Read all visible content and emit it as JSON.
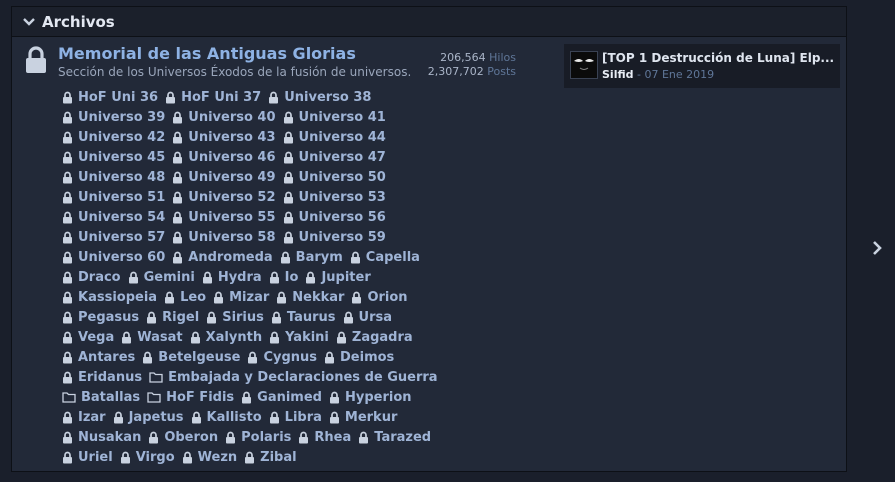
{
  "section": {
    "title": "Archivos"
  },
  "forum": {
    "title": "Memorial de las Antiguas Glorias",
    "description": "Sección de los Universos Éxodos de la fusión de universos.",
    "threads_count": "206,564",
    "threads_label": "Hilos",
    "posts_count": "2,307,702",
    "posts_label": "Posts"
  },
  "last_post": {
    "title": "[TOP 1 Destrucción de Luna] Elp...",
    "user": "Silfid",
    "separator": " - ",
    "date": "07 Ene 2019"
  },
  "subforums": [
    [
      {
        "label": "HoF Uni 36",
        "icon": "lock-icon"
      },
      {
        "label": "HoF Uni 37",
        "icon": "lock-icon"
      },
      {
        "label": "Universo 38",
        "icon": "lock-icon"
      }
    ],
    [
      {
        "label": "Universo 39",
        "icon": "lock-icon"
      },
      {
        "label": "Universo 40",
        "icon": "lock-icon"
      },
      {
        "label": "Universo 41",
        "icon": "lock-icon"
      }
    ],
    [
      {
        "label": "Universo 42",
        "icon": "lock-icon"
      },
      {
        "label": "Universo 43",
        "icon": "lock-icon"
      },
      {
        "label": "Universo 44",
        "icon": "lock-icon"
      }
    ],
    [
      {
        "label": "Universo 45",
        "icon": "lock-icon"
      },
      {
        "label": "Universo 46",
        "icon": "lock-icon"
      },
      {
        "label": "Universo 47",
        "icon": "lock-icon"
      }
    ],
    [
      {
        "label": "Universo 48",
        "icon": "lock-icon"
      },
      {
        "label": "Universo 49",
        "icon": "lock-icon"
      },
      {
        "label": "Universo 50",
        "icon": "lock-icon"
      }
    ],
    [
      {
        "label": "Universo 51",
        "icon": "lock-icon"
      },
      {
        "label": "Universo 52",
        "icon": "lock-icon"
      },
      {
        "label": "Universo 53",
        "icon": "lock-icon"
      }
    ],
    [
      {
        "label": "Universo 54",
        "icon": "lock-icon"
      },
      {
        "label": "Universo 55",
        "icon": "lock-icon"
      },
      {
        "label": "Universo 56",
        "icon": "lock-icon"
      }
    ],
    [
      {
        "label": "Universo 57",
        "icon": "lock-icon"
      },
      {
        "label": "Universo 58",
        "icon": "lock-icon"
      },
      {
        "label": "Universo 59",
        "icon": "lock-icon"
      }
    ],
    [
      {
        "label": "Universo 60",
        "icon": "lock-icon"
      },
      {
        "label": "Andromeda",
        "icon": "lock-icon"
      },
      {
        "label": "Barym",
        "icon": "lock-icon"
      },
      {
        "label": "Capella",
        "icon": "lock-icon"
      }
    ],
    [
      {
        "label": "Draco",
        "icon": "lock-icon"
      },
      {
        "label": "Gemini",
        "icon": "lock-icon"
      },
      {
        "label": "Hydra",
        "icon": "lock-icon"
      },
      {
        "label": "Io",
        "icon": "lock-icon"
      },
      {
        "label": "Jupiter",
        "icon": "lock-icon"
      }
    ],
    [
      {
        "label": "Kassiopeia",
        "icon": "lock-icon"
      },
      {
        "label": "Leo",
        "icon": "lock-icon"
      },
      {
        "label": "Mizar",
        "icon": "lock-icon"
      },
      {
        "label": "Nekkar",
        "icon": "lock-icon"
      },
      {
        "label": "Orion",
        "icon": "lock-icon"
      }
    ],
    [
      {
        "label": "Pegasus",
        "icon": "lock-icon"
      },
      {
        "label": "Rigel",
        "icon": "lock-icon"
      },
      {
        "label": "Sirius",
        "icon": "lock-icon"
      },
      {
        "label": "Taurus",
        "icon": "lock-icon"
      },
      {
        "label": "Ursa",
        "icon": "lock-icon"
      }
    ],
    [
      {
        "label": "Vega",
        "icon": "lock-icon"
      },
      {
        "label": "Wasat",
        "icon": "lock-icon"
      },
      {
        "label": "Xalynth",
        "icon": "lock-icon"
      },
      {
        "label": "Yakini",
        "icon": "lock-icon"
      },
      {
        "label": "Zagadra",
        "icon": "lock-icon"
      }
    ],
    [
      {
        "label": "Antares",
        "icon": "lock-icon"
      },
      {
        "label": "Betelgeuse",
        "icon": "lock-icon"
      },
      {
        "label": "Cygnus",
        "icon": "lock-icon"
      },
      {
        "label": "Deimos",
        "icon": "lock-icon"
      }
    ],
    [
      {
        "label": "Eridanus",
        "icon": "lock-icon"
      },
      {
        "label": "Embajada y Declaraciones de Guerra",
        "icon": "folder-icon"
      }
    ],
    [
      {
        "label": "Batallas",
        "icon": "folder-icon"
      },
      {
        "label": "HoF Fidis",
        "icon": "folder-icon"
      },
      {
        "label": "Ganimed",
        "icon": "lock-icon"
      },
      {
        "label": "Hyperion",
        "icon": "lock-icon"
      }
    ],
    [
      {
        "label": "Izar",
        "icon": "lock-icon"
      },
      {
        "label": "Japetus",
        "icon": "lock-icon"
      },
      {
        "label": "Kallisto",
        "icon": "lock-icon"
      },
      {
        "label": "Libra",
        "icon": "lock-icon"
      },
      {
        "label": "Merkur",
        "icon": "lock-icon"
      }
    ],
    [
      {
        "label": "Nusakan",
        "icon": "lock-icon"
      },
      {
        "label": "Oberon",
        "icon": "lock-icon"
      },
      {
        "label": "Polaris",
        "icon": "lock-icon"
      },
      {
        "label": "Rhea",
        "icon": "lock-icon"
      },
      {
        "label": "Tarazed",
        "icon": "lock-icon"
      }
    ],
    [
      {
        "label": "Uriel",
        "icon": "lock-icon"
      },
      {
        "label": "Virgo",
        "icon": "lock-icon"
      },
      {
        "label": "Wezn",
        "icon": "lock-icon"
      },
      {
        "label": "Zibal",
        "icon": "lock-icon"
      }
    ]
  ]
}
